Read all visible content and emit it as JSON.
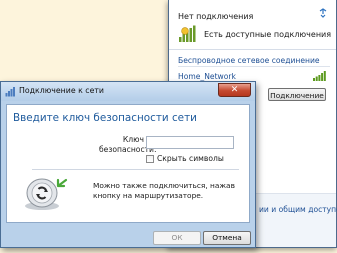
{
  "flyout": {
    "title": "Нет подключения",
    "available_text": "Есть доступные подключения",
    "section_heading": "Беспроводное сетевое соединение",
    "network_name": "Home_Network",
    "connect_label": "Подключение",
    "footer_link": "ии и общим доступом"
  },
  "dialog": {
    "title": "Подключение к сети",
    "close_glyph": "✕",
    "heading": "Введите ключ безопасности сети",
    "key_label_line1": "Ключ",
    "key_label_line2": "безопасности:",
    "key_value": "",
    "hide_chars_label": "Скрыть символы",
    "hide_chars_checked": false,
    "router_text_line1": "Можно также подключиться, нажав",
    "router_text_line2": "кнопку на маршрутизаторе.",
    "ok_label": "ОК",
    "cancel_label": "Отмена"
  },
  "colors": {
    "background": "#fdf4dc",
    "link_blue": "#1e4f94",
    "heading_blue": "#1e5a9c",
    "dialog_frame": "#b9d1ea",
    "close_red": "#c54a31"
  },
  "icons": {
    "refresh": "refresh-icon",
    "available": "network-available-icon",
    "signal": "signal-strength-icon",
    "dialog": "network-icon",
    "router": "router-wps-icon"
  }
}
